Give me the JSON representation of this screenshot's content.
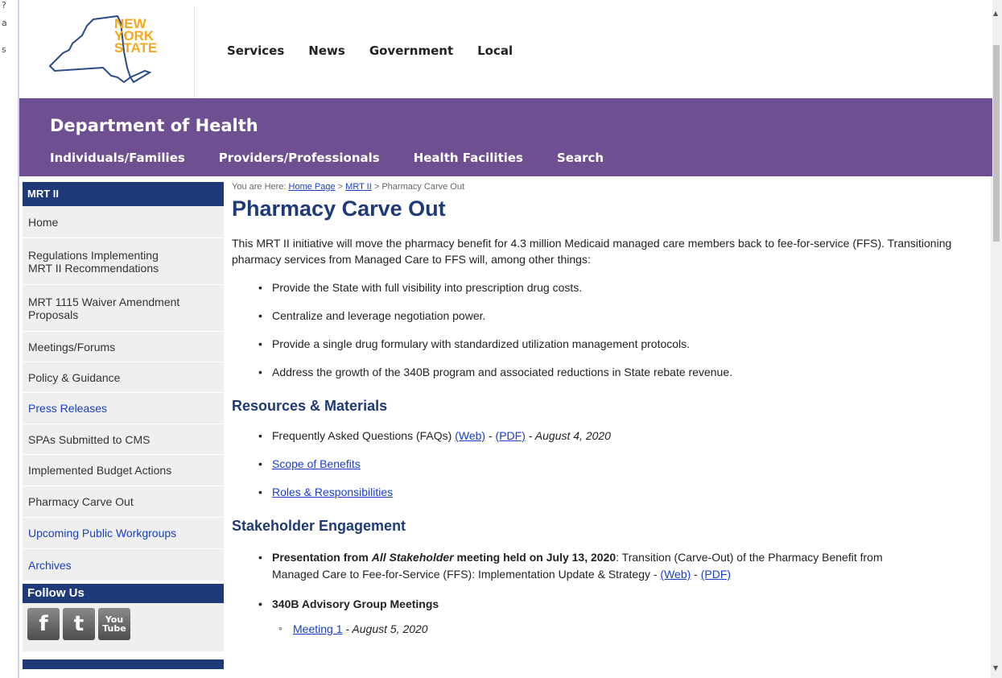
{
  "edge_fragments": [
    "?",
    "a",
    "s"
  ],
  "logo": {
    "line1": "NEW",
    "line2": "YORK",
    "line3": "STATE"
  },
  "top_nav": [
    "Services",
    "News",
    "Government",
    "Local"
  ],
  "banner": {
    "title": "Department of Health",
    "nav": [
      "Individuals/Families",
      "Providers/Professionals",
      "Health Facilities",
      "Search"
    ]
  },
  "sidebar": {
    "header": "MRT II",
    "items": [
      {
        "label": "Home",
        "color": "#333333"
      },
      {
        "label": "Regulations Implementing\nMRT II Recommendations",
        "color": "#333333"
      },
      {
        "label": "MRT 1115 Waiver Amendment\nProposals",
        "color": "#333333"
      },
      {
        "label": "Meetings/Forums",
        "color": "#333333"
      },
      {
        "label": "Policy & Guidance",
        "color": "#333333"
      },
      {
        "label": "Press Releases",
        "color": "#1a3fc4"
      },
      {
        "label": "SPAs Submitted to CMS",
        "color": "#333333"
      },
      {
        "label": "Implemented Budget Actions",
        "color": "#333333"
      },
      {
        "label": "Pharmacy Carve Out",
        "color": "#333333"
      },
      {
        "label": "Upcoming Public Workgroups",
        "color": "#1a3fc4"
      },
      {
        "label": "Archives",
        "color": "#1a3fc4"
      }
    ],
    "follow_header": "Follow Us",
    "social": [
      {
        "name": "facebook-icon",
        "glyph": "f"
      },
      {
        "name": "twitter-icon",
        "glyph": "t"
      },
      {
        "name": "youtube-icon",
        "glyph": "You\nTube"
      }
    ]
  },
  "breadcrumb": {
    "prefix": "You are Here: ",
    "home": "Home Page",
    "sep1": " > ",
    "mrt": "MRT II",
    "sep2": " > ",
    "current": "Pharmacy Carve Out"
  },
  "page_title": "Pharmacy Carve Out",
  "intro": "This MRT II initiative will move the pharmacy benefit for 4.3 million Medicaid managed care members back to fee-for-service (FFS). Transitioning pharmacy services from Managed Care to FFS will, among other things:",
  "goals": [
    "Provide the State with full visibility into prescription drug costs.",
    "Centralize and leverage negotiation power.",
    "Provide a single drug formulary with standardized utilization management protocols.",
    "Address the growth of the 340B program and associated reductions in State rebate revenue."
  ],
  "resources": {
    "heading": "Resources & Materials",
    "faq_text": "Frequently Asked Questions (FAQs) ",
    "faq_web": "(Web)",
    "faq_sep": " - ",
    "faq_pdf": "(PDF)",
    "faq_date": " - August 4, 2020",
    "scope": "Scope of Benefits",
    "roles": "Roles & Responsibilities"
  },
  "stakeholder": {
    "heading": "Stakeholder Engagement",
    "pres_bold1": "Presentation from ",
    "pres_bold_italic": "All Stakeholder",
    "pres_bold2": " meeting held on July 13, 2020",
    "pres_rest": ": Transition (Carve-Out) of the Pharmacy Benefit from Managed Care to Fee-for-Service (FFS): Implementation Update & Strategy - ",
    "pres_web": "(Web)",
    "pres_sep": " - ",
    "pres_pdf": "(PDF)",
    "advisory": "340B Advisory Group Meetings",
    "meeting1": "Meeting 1",
    "meeting1_date": " - August 5, 2020"
  }
}
